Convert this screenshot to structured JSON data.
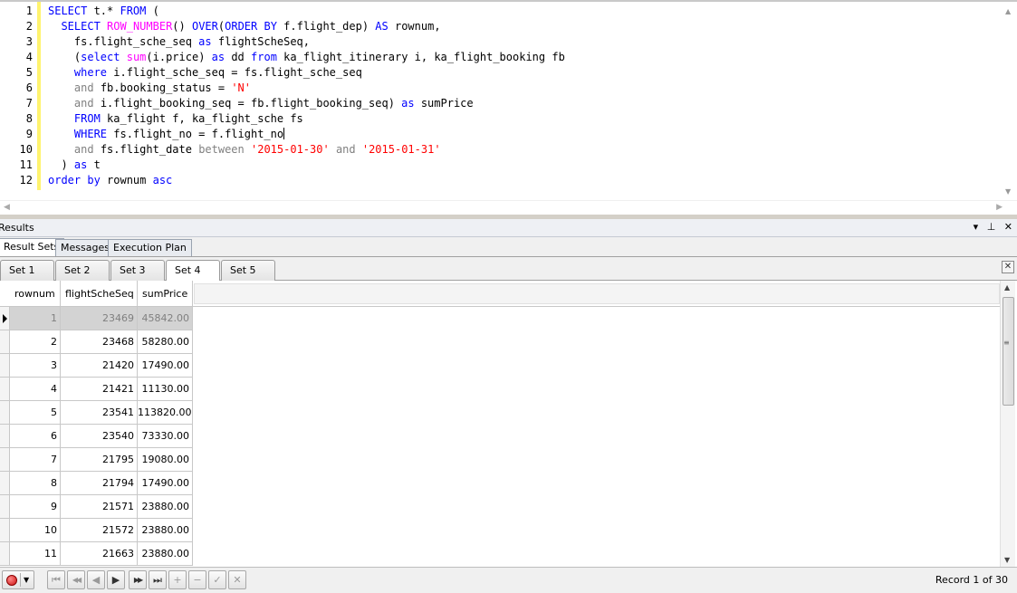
{
  "editor": {
    "line_numbers": [
      "1",
      "2",
      "3",
      "4",
      "5",
      "6",
      "7",
      "8",
      "9",
      "10",
      "11",
      "12"
    ],
    "lines": [
      [
        [
          "kw",
          "SELECT"
        ],
        [
          "p",
          " t.* "
        ],
        [
          "kw",
          "FROM"
        ],
        [
          "p",
          " ("
        ]
      ],
      [
        [
          "p",
          "  "
        ],
        [
          "kw",
          "SELECT"
        ],
        [
          "p",
          " "
        ],
        [
          "fn",
          "ROW_NUMBER"
        ],
        [
          "p",
          "() "
        ],
        [
          "kw",
          "OVER"
        ],
        [
          "p",
          "("
        ],
        [
          "kw",
          "ORDER BY"
        ],
        [
          "p",
          " f.flight_dep) "
        ],
        [
          "kw",
          "AS"
        ],
        [
          "p",
          " rownum,"
        ]
      ],
      [
        [
          "p",
          "    fs.flight_sche_seq "
        ],
        [
          "kw",
          "as"
        ],
        [
          "p",
          " flightScheSeq,"
        ]
      ],
      [
        [
          "p",
          "    ("
        ],
        [
          "kw",
          "select"
        ],
        [
          "p",
          " "
        ],
        [
          "fn",
          "sum"
        ],
        [
          "p",
          "(i.price) "
        ],
        [
          "kw",
          "as"
        ],
        [
          "p",
          " dd "
        ],
        [
          "kw",
          "from"
        ],
        [
          "p",
          " ka_flight_itinerary i, ka_flight_booking fb"
        ]
      ],
      [
        [
          "p",
          "    "
        ],
        [
          "kw",
          "where"
        ],
        [
          "p",
          " i.flight_sche_seq = fs.flight_sche_seq"
        ]
      ],
      [
        [
          "p",
          "    "
        ],
        [
          "gr",
          "and"
        ],
        [
          "p",
          " fb.booking_status = "
        ],
        [
          "st",
          "'N'"
        ]
      ],
      [
        [
          "p",
          "    "
        ],
        [
          "gr",
          "and"
        ],
        [
          "p",
          " i.flight_booking_seq = fb.flight_booking_seq) "
        ],
        [
          "kw",
          "as"
        ],
        [
          "p",
          " sumPrice"
        ]
      ],
      [
        [
          "p",
          "    "
        ],
        [
          "kw",
          "FROM"
        ],
        [
          "p",
          " ka_flight f, ka_flight_sche fs"
        ]
      ],
      [
        [
          "p",
          "    "
        ],
        [
          "kw",
          "WHERE"
        ],
        [
          "p",
          " fs.flight_no = f.flight_no"
        ],
        [
          "caret",
          ""
        ]
      ],
      [
        [
          "p",
          "    "
        ],
        [
          "gr",
          "and"
        ],
        [
          "p",
          " fs.flight_date "
        ],
        [
          "gr",
          "between"
        ],
        [
          "p",
          " "
        ],
        [
          "st",
          "'2015-01-30'"
        ],
        [
          "p",
          " "
        ],
        [
          "gr",
          "and"
        ],
        [
          "p",
          " "
        ],
        [
          "st",
          "'2015-01-31'"
        ]
      ],
      [
        [
          "p",
          "  ) "
        ],
        [
          "kw",
          "as"
        ],
        [
          "p",
          " t"
        ]
      ],
      [
        [
          "kw",
          "order by"
        ],
        [
          "p",
          " rownum "
        ],
        [
          "kw",
          "asc"
        ]
      ]
    ]
  },
  "results": {
    "title": "Results",
    "controls": "▾ ⊥ ✕",
    "tabs": [
      "Result Sets",
      "Messages",
      "Execution Plan"
    ],
    "active_tab": "Result Sets",
    "set_tabs": [
      "Set 1",
      "Set 2",
      "Set 3",
      "Set 4",
      "Set 5"
    ],
    "active_set": "Set 4",
    "close_label": "✕"
  },
  "grid": {
    "columns": [
      "rownum",
      "flightScheSeq",
      "sumPrice"
    ],
    "rows": [
      [
        "1",
        "23469",
        "45842.00"
      ],
      [
        "2",
        "23468",
        "58280.00"
      ],
      [
        "3",
        "21420",
        "17490.00"
      ],
      [
        "4",
        "21421",
        "11130.00"
      ],
      [
        "5",
        "23541",
        "113820.00"
      ],
      [
        "6",
        "23540",
        "73330.00"
      ],
      [
        "7",
        "21795",
        "19080.00"
      ],
      [
        "8",
        "21794",
        "17490.00"
      ],
      [
        "9",
        "21571",
        "23880.00"
      ],
      [
        "10",
        "21572",
        "23880.00"
      ],
      [
        "11",
        "21663",
        "23880.00"
      ]
    ],
    "selected_row": 0
  },
  "navigator": {
    "buttons": [
      {
        "name": "first-record-button",
        "glyph": "⏮",
        "dim": true
      },
      {
        "name": "prev-page-button",
        "glyph": "◀◀",
        "dim": true
      },
      {
        "name": "prev-record-button",
        "glyph": "◀",
        "dim": true
      },
      {
        "name": "next-record-button",
        "glyph": "▶",
        "dim": false
      },
      {
        "name": "next-page-button",
        "glyph": "▶▶",
        "dim": false
      },
      {
        "name": "last-record-button",
        "glyph": "⏭",
        "dim": false
      },
      {
        "name": "add-record-button",
        "glyph": "+",
        "dim": true
      },
      {
        "name": "delete-record-button",
        "glyph": "−",
        "dim": true
      },
      {
        "name": "post-edit-button",
        "glyph": "✓",
        "dim": true
      },
      {
        "name": "cancel-edit-button",
        "glyph": "✕",
        "dim": true
      }
    ],
    "record_info": "Record 1 of 30"
  }
}
